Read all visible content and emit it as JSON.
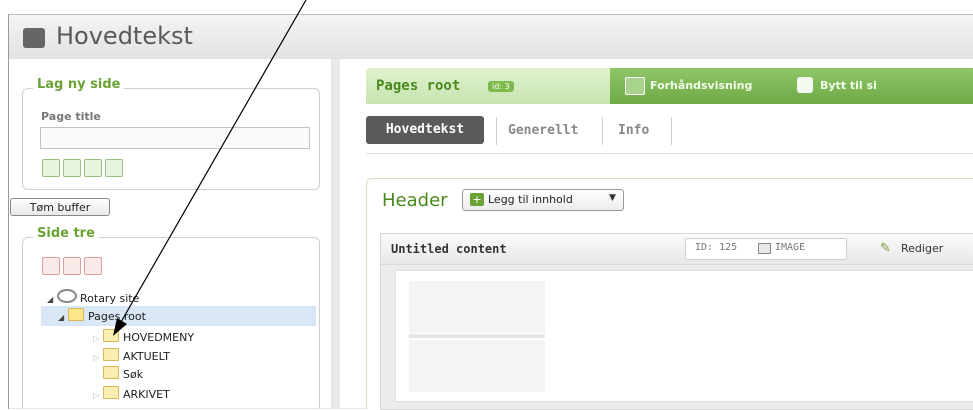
{
  "window": {
    "title": "Hovedtekst"
  },
  "left": {
    "new_page": {
      "legend": "Lag ny side",
      "page_title_label": "Page title",
      "page_title_value": "",
      "toolbar_icons": [
        "add-page-icon",
        "add-below-icon",
        "add-child-icon",
        "add-sibling-icon"
      ]
    },
    "buffer_button": "Tøm buffer",
    "tree": {
      "legend": "Side tre",
      "toolbar_icons": [
        "delete-page-icon",
        "copy-page-icon",
        "paste-page-icon"
      ],
      "nodes": [
        {
          "label": "Rotary site",
          "expanded": true,
          "icon": "site-icon"
        },
        {
          "label": "Pages root",
          "expanded": true,
          "selected": true,
          "icon": "folder-open-icon"
        },
        {
          "label": "HOVEDMENY",
          "expanded": false,
          "icon": "folder-icon"
        },
        {
          "label": "AKTUELT",
          "expanded": false,
          "icon": "folder-icon"
        },
        {
          "label": "Søk",
          "expanded": null,
          "icon": "folder-icon"
        },
        {
          "label": "ARKIVET",
          "expanded": false,
          "icon": "folder-icon"
        }
      ]
    }
  },
  "right": {
    "page_header": {
      "title": "Pages root",
      "id_badge": "id: 3",
      "preview_label": "Forhåndsvisning",
      "switch_label": "Bytt til si"
    },
    "tabs": [
      {
        "label": "Hovedtekst",
        "active": true
      },
      {
        "label": "Generellt",
        "active": false
      },
      {
        "label": "Info",
        "active": false
      }
    ],
    "section": {
      "title": "Header",
      "add_button": "Legg til innhold"
    },
    "content_item": {
      "title": "Untitled content",
      "id_label": "ID: 125",
      "type_label": "IMAGE",
      "edit_label": "Rediger"
    }
  },
  "colors": {
    "accent_green": "#6aa233",
    "selected_row": "#d8e6f5",
    "active_tab": "#5a5a5a"
  }
}
